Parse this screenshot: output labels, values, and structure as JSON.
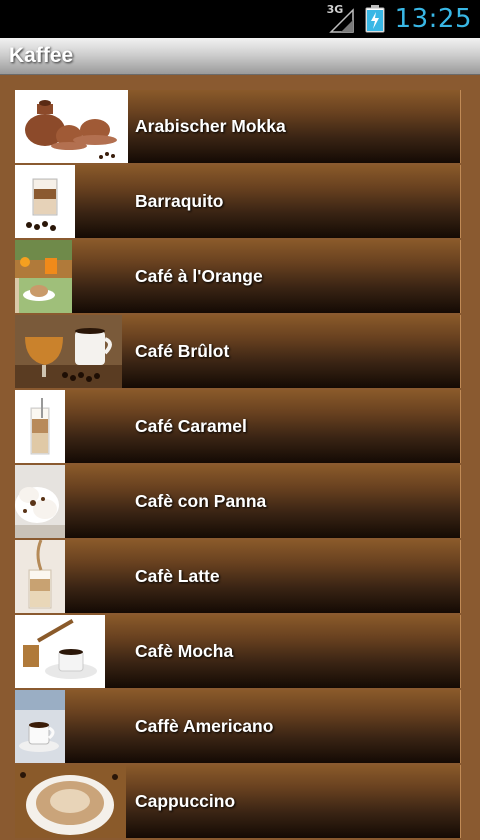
{
  "status_bar": {
    "network": "3G",
    "time": "13:25",
    "icons": [
      "network-3g-icon",
      "signal-icon",
      "battery-charging-icon"
    ]
  },
  "header": {
    "title": "Kaffee"
  },
  "items": [
    {
      "label": "Arabischer Mokka"
    },
    {
      "label": "Barraquito"
    },
    {
      "label": "Café à l'Orange"
    },
    {
      "label": "Café Brûlot"
    },
    {
      "label": "Café Caramel"
    },
    {
      "label": "Cafè con Panna"
    },
    {
      "label": "Cafè Latte"
    },
    {
      "label": "Cafè Mocha"
    },
    {
      "label": "Caffè Americano"
    },
    {
      "label": "Cappuccino"
    }
  ],
  "colors": {
    "background": "#8a5a30",
    "clock": "#39b7e5",
    "row_top": "#8a5a2a",
    "row_bottom": "#140a04"
  }
}
